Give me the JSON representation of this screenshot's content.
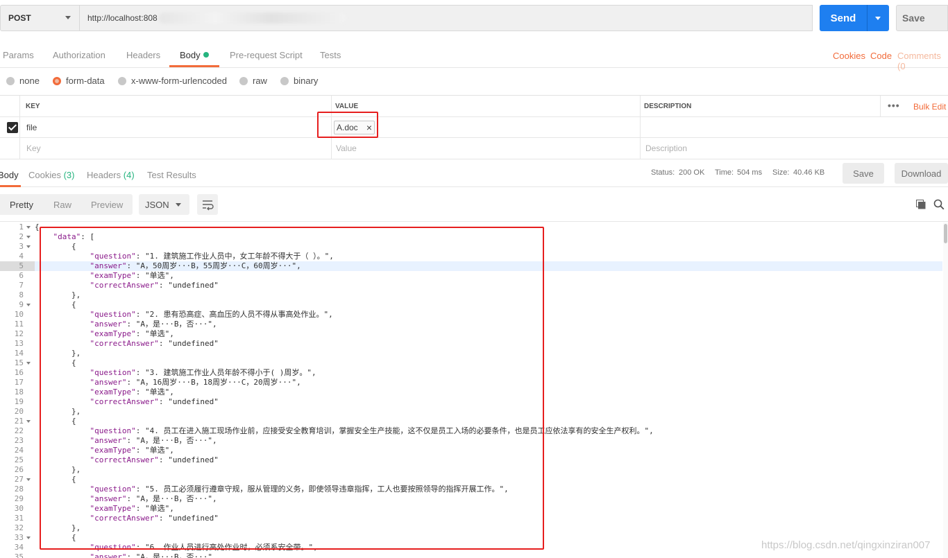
{
  "request": {
    "method": "POST",
    "url": "http://localhost:808",
    "send_label": "Send",
    "save_label": "Save"
  },
  "request_tabs": {
    "params": "Params",
    "authorization": "Authorization",
    "headers": "Headers",
    "body": "Body",
    "prerequest": "Pre-request Script",
    "tests": "Tests",
    "cookies": "Cookies",
    "code": "Code",
    "comments": "Comments (0"
  },
  "body_types": {
    "none": "none",
    "form_data": "form-data",
    "urlencoded": "x-www-form-urlencoded",
    "raw": "raw",
    "binary": "binary"
  },
  "kv_table": {
    "headers": {
      "key": "KEY",
      "value": "VALUE",
      "description": "DESCRIPTION",
      "more": "•••",
      "bulk_edit": "Bulk Edit"
    },
    "row": {
      "key": "file",
      "value": "A.doc"
    },
    "placeholders": {
      "key": "Key",
      "value": "Value",
      "description": "Description"
    }
  },
  "response_tabs": {
    "body": "Body",
    "cookies": "Cookies",
    "cookies_count": "(3)",
    "headers": "Headers",
    "headers_count": "(4)",
    "test_results": "Test Results",
    "status_label": "Status:",
    "status_value": "200 OK",
    "time_label": "Time:",
    "time_value": "504 ms",
    "size_label": "Size:",
    "size_value": "40.46 KB",
    "save": "Save",
    "download": "Download"
  },
  "view_bar": {
    "pretty": "Pretty",
    "raw": "Raw",
    "preview": "Preview",
    "format": "JSON"
  },
  "colors": {
    "accent": "#f26b3a",
    "send": "#1e7ff0",
    "success": "#26b47f",
    "annotation": "#e61e1e"
  },
  "icons": [
    "chevron-down-icon",
    "close-icon",
    "check-icon",
    "wrap-icon",
    "copy-icon",
    "search-icon"
  ],
  "code_lines": [
    {
      "n": "1",
      "fold": true,
      "text": "{"
    },
    {
      "n": "2",
      "fold": true,
      "text": "    \"data\": ["
    },
    {
      "n": "3",
      "fold": true,
      "text": "        {"
    },
    {
      "n": "4",
      "fold": false,
      "text": "            \"question\": \"1. 建筑施工作业人员中，女工年龄不得大于（ ）。\","
    },
    {
      "n": "5",
      "fold": false,
      "text": "            \"answer\": \"A，50周岁···B，55周岁···C，60周岁···\","
    },
    {
      "n": "6",
      "fold": false,
      "text": "            \"examType\": \"单选\","
    },
    {
      "n": "7",
      "fold": false,
      "text": "            \"correctAnswer\": \"undefined\""
    },
    {
      "n": "8",
      "fold": false,
      "text": "        },"
    },
    {
      "n": "9",
      "fold": true,
      "text": "        {"
    },
    {
      "n": "10",
      "fold": false,
      "text": "            \"question\": \"2. 患有恐高症、高血压的人员不得从事高处作业。\","
    },
    {
      "n": "11",
      "fold": false,
      "text": "            \"answer\": \"A，是···B，否···\","
    },
    {
      "n": "12",
      "fold": false,
      "text": "            \"examType\": \"单选\","
    },
    {
      "n": "13",
      "fold": false,
      "text": "            \"correctAnswer\": \"undefined\""
    },
    {
      "n": "14",
      "fold": false,
      "text": "        },"
    },
    {
      "n": "15",
      "fold": true,
      "text": "        {"
    },
    {
      "n": "16",
      "fold": false,
      "text": "            \"question\": \"3. 建筑施工作业人员年龄不得小于( )周岁。\","
    },
    {
      "n": "17",
      "fold": false,
      "text": "            \"answer\": \"A，16周岁···B，18周岁···C，20周岁···\","
    },
    {
      "n": "18",
      "fold": false,
      "text": "            \"examType\": \"单选\","
    },
    {
      "n": "19",
      "fold": false,
      "text": "            \"correctAnswer\": \"undefined\""
    },
    {
      "n": "20",
      "fold": false,
      "text": "        },"
    },
    {
      "n": "21",
      "fold": true,
      "text": "        {"
    },
    {
      "n": "22",
      "fold": false,
      "text": "            \"question\": \"4. 员工在进入施工现场作业前，应接受安全教育培训，掌握安全生产技能，这不仅是员工入场的必要条件，也是员工应依法享有的安全生产权利。\","
    },
    {
      "n": "23",
      "fold": false,
      "text": "            \"answer\": \"A，是···B，否···\","
    },
    {
      "n": "24",
      "fold": false,
      "text": "            \"examType\": \"单选\","
    },
    {
      "n": "25",
      "fold": false,
      "text": "            \"correctAnswer\": \"undefined\""
    },
    {
      "n": "26",
      "fold": false,
      "text": "        },"
    },
    {
      "n": "27",
      "fold": true,
      "text": "        {"
    },
    {
      "n": "28",
      "fold": false,
      "text": "            \"question\": \"5. 员工必须履行遵章守规，服从管理的义务，即使领导违章指挥，工人也要按照领导的指挥开展工作。\","
    },
    {
      "n": "29",
      "fold": false,
      "text": "            \"answer\": \"A，是···B，否···\","
    },
    {
      "n": "30",
      "fold": false,
      "text": "            \"examType\": \"单选\","
    },
    {
      "n": "31",
      "fold": false,
      "text": "            \"correctAnswer\": \"undefined\""
    },
    {
      "n": "32",
      "fold": false,
      "text": "        },"
    },
    {
      "n": "33",
      "fold": true,
      "text": "        {"
    },
    {
      "n": "34",
      "fold": false,
      "text": "            \"question\": \"6. 作业人员进行高处作业时，必须系安全带。\","
    },
    {
      "n": "35",
      "fold": false,
      "text": "            \"answer\": \"A，是···B，否···\","
    }
  ],
  "highlighted_line": "5",
  "watermark": "https://blog.csdn.net/qingxinziran007"
}
